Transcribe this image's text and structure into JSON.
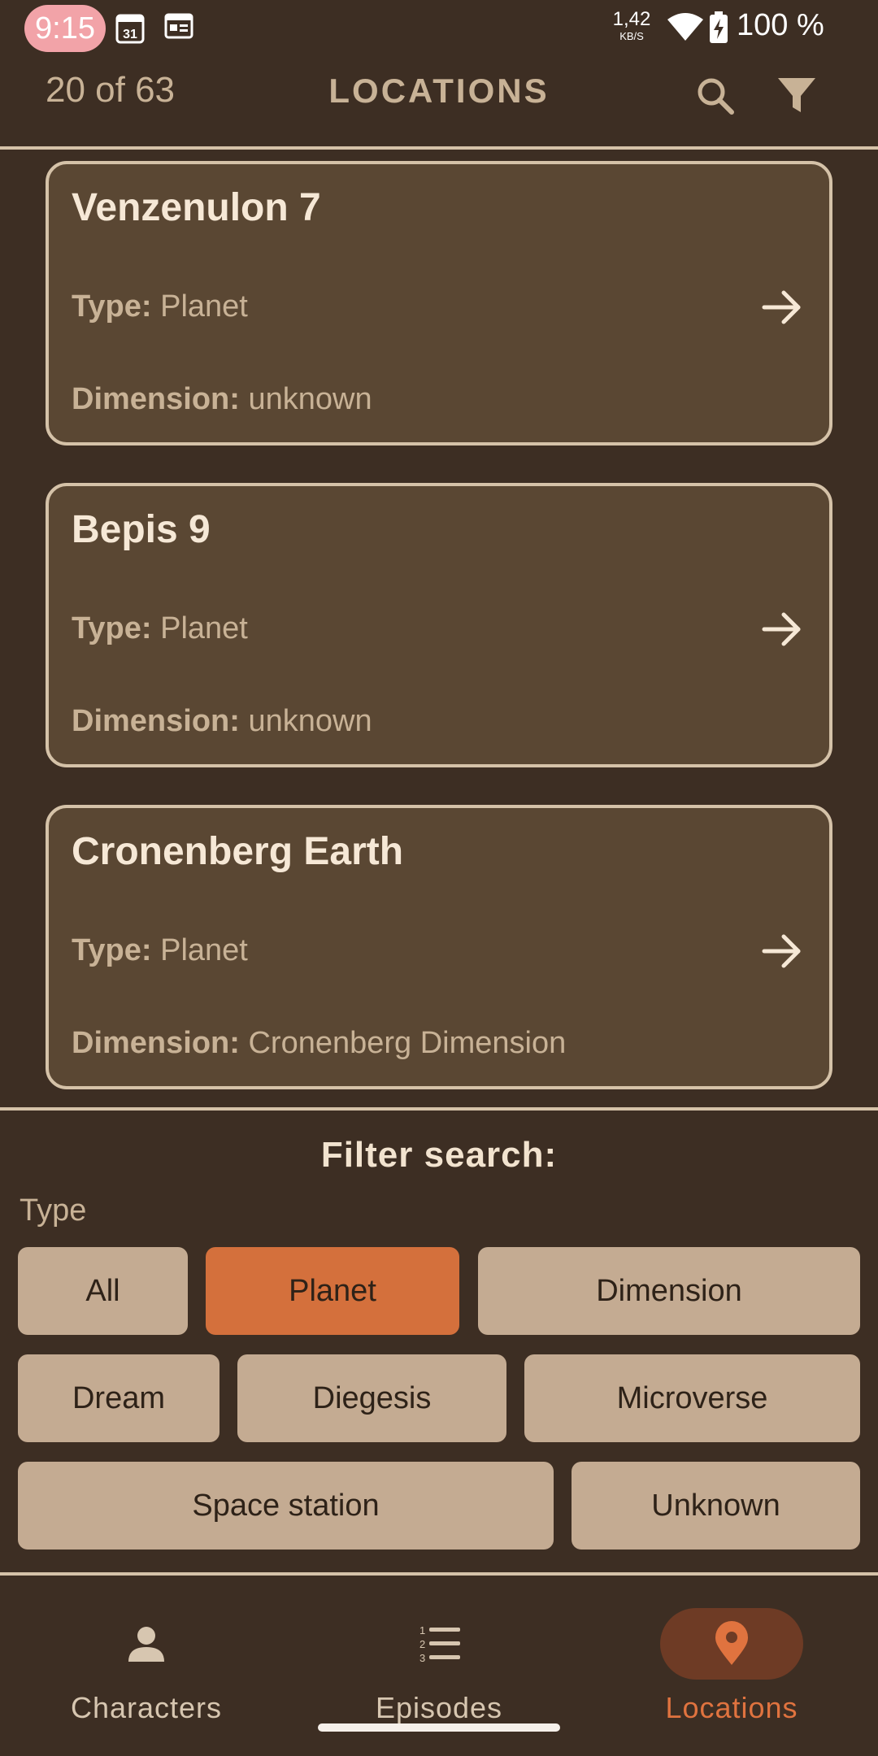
{
  "status_bar": {
    "time": "9:15",
    "calendar_day": "31",
    "net_speed_value": "1,42",
    "net_speed_unit": "KB/S",
    "battery": "100 %"
  },
  "app_bar": {
    "count": "20 of 63",
    "title": "LOCATIONS",
    "search_icon": "search-icon",
    "filter_icon": "filter-icon"
  },
  "locations": [
    {
      "name": "Venzenulon 7",
      "type_label": "Type:",
      "type": "Planet",
      "dimension_label": "Dimension:",
      "dimension": "unknown"
    },
    {
      "name": "Bepis 9",
      "type_label": "Type:",
      "type": "Planet",
      "dimension_label": "Dimension:",
      "dimension": "unknown"
    },
    {
      "name": "Cronenberg Earth",
      "type_label": "Type:",
      "type": "Planet",
      "dimension_label": "Dimension:",
      "dimension": "Cronenberg Dimension"
    }
  ],
  "filter": {
    "title": "Filter search:",
    "label": "Type",
    "options": [
      "All",
      "Planet",
      "Dimension",
      "Dream",
      "Diegesis",
      "Microverse",
      "Space station",
      "Unknown"
    ],
    "selected": "Planet"
  },
  "bottom_nav": {
    "items": [
      {
        "label": "Characters",
        "icon": "person-icon"
      },
      {
        "label": "Episodes",
        "icon": "numbered-list-icon"
      },
      {
        "label": "Locations",
        "icon": "location-pin-icon"
      }
    ],
    "active": "Locations"
  },
  "colors": {
    "background": "#3d2e23",
    "card": "#5a4733",
    "chip": "#c4ab92",
    "accent": "#d4703c"
  }
}
